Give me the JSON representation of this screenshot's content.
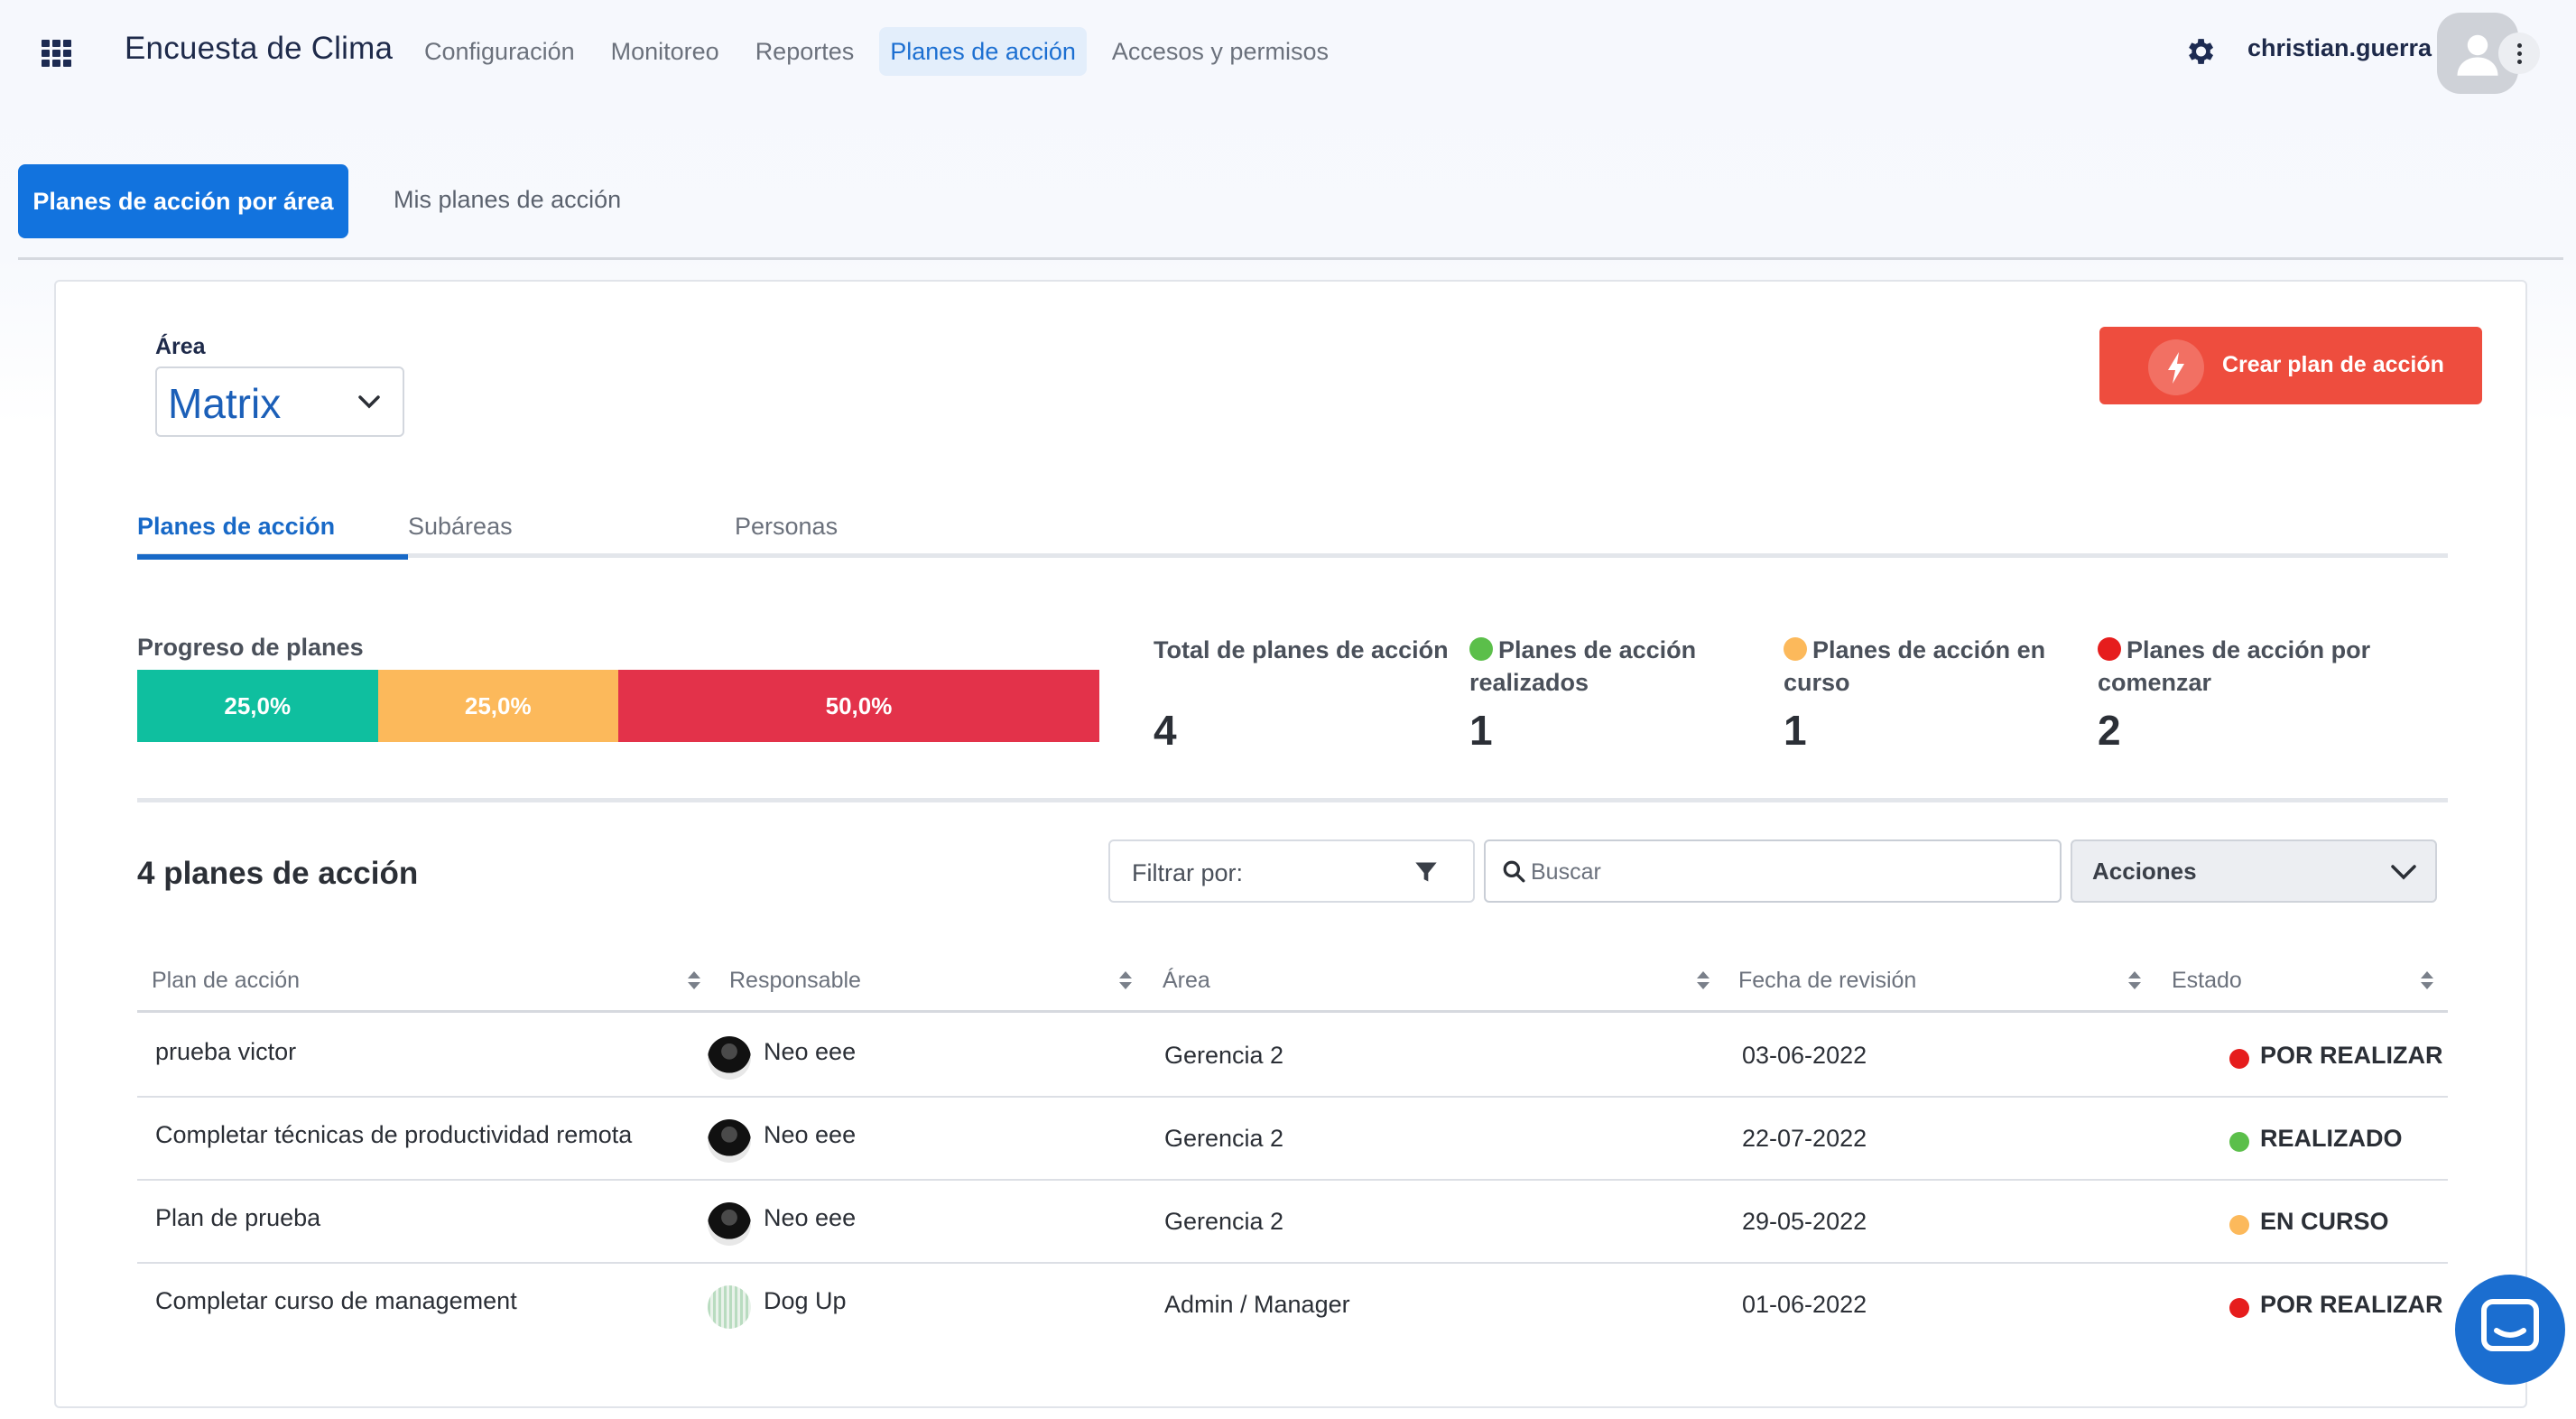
{
  "app": {
    "title": "Encuesta de Clima",
    "nav": [
      "Configuración",
      "Monitoreo",
      "Reportes",
      "Planes de acción",
      "Accesos y permisos"
    ],
    "active_nav": "Planes de acción",
    "username": "christian.guerra"
  },
  "tabs": {
    "primary": "Planes de acción por área",
    "secondary": "Mis planes de acción"
  },
  "area": {
    "label": "Área",
    "value": "Matrix"
  },
  "create_button": "Crear plan de acción",
  "inner_tabs": [
    "Planes de acción",
    "Subáreas",
    "Personas"
  ],
  "progress": {
    "title": "Progreso de planes",
    "segments": [
      {
        "label": "25,0%",
        "value": 25.0,
        "color": "#0fbf9f"
      },
      {
        "label": "25,0%",
        "value": 25.0,
        "color": "#fcb95b"
      },
      {
        "label": "50,0%",
        "value": 50.0,
        "color": "#e3324a"
      }
    ]
  },
  "stats": [
    {
      "label": "Total de planes de acción",
      "value": "4",
      "dot": ""
    },
    {
      "label": "Planes de acción realizados",
      "value": "1",
      "dot": "#5bbf4a"
    },
    {
      "label": "Planes de acción en curso",
      "value": "1",
      "dot": "#fcb95b"
    },
    {
      "label": "Planes de acción por comenzar",
      "value": "2",
      "dot": "#e61d1d"
    }
  ],
  "list": {
    "title": "4 planes de acción",
    "filter_label": "Filtrar por:",
    "search_placeholder": "Buscar",
    "actions_label": "Acciones",
    "columns": [
      "Plan de acción",
      "Responsable",
      "Área",
      "Fecha de revisión",
      "Estado"
    ],
    "rows": [
      {
        "plan": "prueba victor",
        "responsable": "Neo eee",
        "area": "Gerencia 2",
        "fecha": "03-06-2022",
        "estado": "POR REALIZAR",
        "estado_color": "#e61d1d",
        "avatar": "dark"
      },
      {
        "plan": "Completar técnicas de productividad remota",
        "responsable": "Neo eee",
        "area": "Gerencia 2",
        "fecha": "22-07-2022",
        "estado": "REALIZADO",
        "estado_color": "#5bbf4a",
        "avatar": "dark"
      },
      {
        "plan": "Plan de prueba",
        "responsable": "Neo eee",
        "area": "Gerencia 2",
        "fecha": "29-05-2022",
        "estado": "EN CURSO",
        "estado_color": "#fcb95b",
        "avatar": "dark"
      },
      {
        "plan": "Completar curso de management",
        "responsable": "Dog Up",
        "area": "Admin / Manager",
        "fecha": "01-06-2022",
        "estado": "POR REALIZAR",
        "estado_color": "#e61d1d",
        "avatar": "light"
      }
    ]
  }
}
